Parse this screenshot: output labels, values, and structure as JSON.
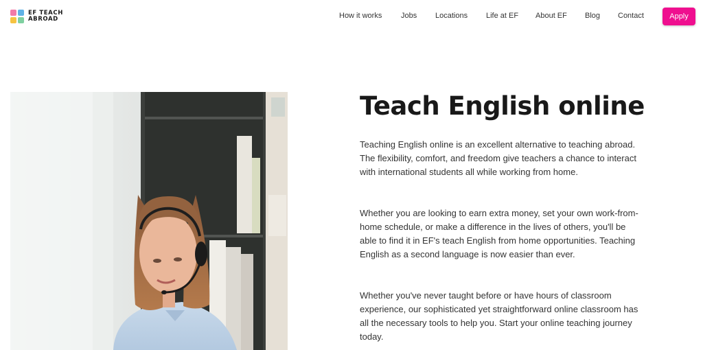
{
  "brand": {
    "line1": "EF TEACH",
    "line2": "ABROAD",
    "colors": [
      "#f27aa8",
      "#5fb2e6",
      "#f6c342",
      "#7fd0a0"
    ]
  },
  "nav": {
    "items": [
      "How it works",
      "Jobs",
      "Locations",
      "Life at EF",
      "About EF",
      "Blog",
      "Contact"
    ],
    "apply_label": "Apply",
    "accent_color": "#ef0f8f"
  },
  "hero": {
    "title": "Teach English online",
    "paragraphs": [
      "Teaching English online is an excellent alternative to teaching abroad. The flexibility, comfort, and freedom give teachers a chance to interact with international students all while working from home.",
      "Whether you are looking to earn extra money, set your own work-from-home schedule, or make a difference in the lives of others, you'll be able to find it in EF's teach English from home opportunities. Teaching English as a second language is now easier than ever.",
      "Whether you've never taught before or have hours of classroom experience, our sophisticated yet straightforward online classroom has all the necessary tools to help you. Start your online teaching journey today."
    ]
  }
}
